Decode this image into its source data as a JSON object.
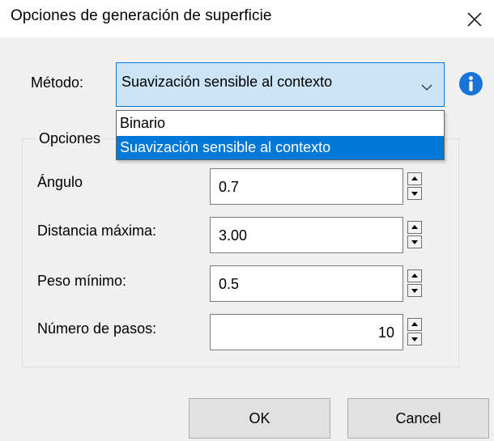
{
  "window": {
    "title": "Opciones de generación de superficie"
  },
  "method": {
    "label": "Método:",
    "selected": "Suavización sensible al contexto",
    "options": [
      "Binario",
      "Suavización sensible al contexto"
    ],
    "highlighted_index": 1
  },
  "options_group": {
    "title": "Opciones"
  },
  "fields": [
    {
      "label": "Ángulo",
      "value": "0.7"
    },
    {
      "label": "Distancia máxima:",
      "value": "3.00"
    },
    {
      "label": "Peso mínimo:",
      "value": "0.5"
    },
    {
      "label": "Número de pasos:",
      "value": "10"
    }
  ],
  "buttons": {
    "ok": "OK",
    "cancel": "Cancel"
  },
  "colors": {
    "accent": "#0078d7",
    "combo_bg": "#cce4f7",
    "info_icon": "#1a73d8"
  }
}
